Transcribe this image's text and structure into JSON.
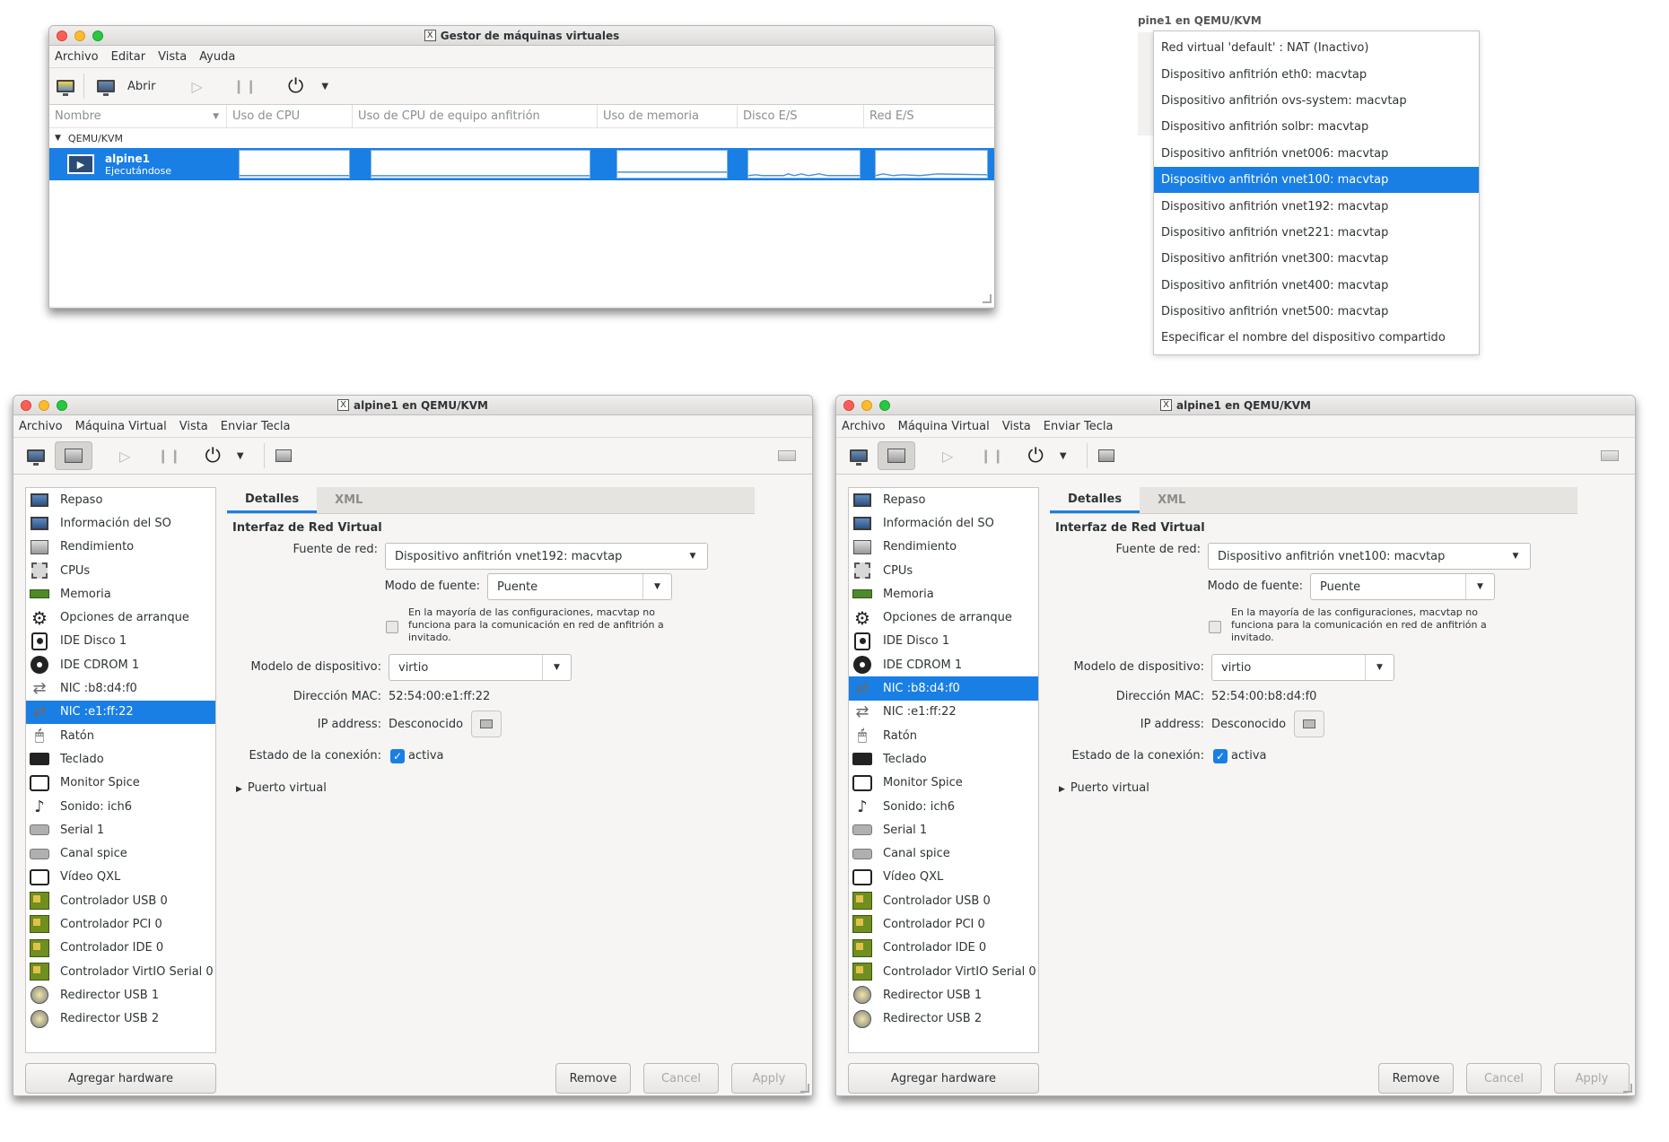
{
  "manager": {
    "title": "Gestor de máquinas virtuales",
    "menu": [
      "Archivo",
      "Editar",
      "Vista",
      "Ayuda"
    ],
    "open_label": "Abrir",
    "columns": [
      "Nombre",
      "Uso de CPU",
      "Uso de CPU de equipo anfitrión",
      "Uso de memoria",
      "Disco E/S",
      "Red E/S"
    ],
    "group": "QEMU/KVM",
    "vm_name": "alpine1",
    "vm_state": "Ejecutándose"
  },
  "popup": {
    "partial_title": "pine1 en QEMU/KVM",
    "items": [
      "Red virtual 'default' : NAT (Inactivo)",
      "Dispositivo anfitrión eth0: macvtap",
      "Dispositivo anfitrión ovs-system: macvtap",
      "Dispositivo anfitrión solbr: macvtap",
      "Dispositivo anfitrión vnet006: macvtap",
      "Dispositivo anfitrión vnet100: macvtap",
      "Dispositivo anfitrión vnet192: macvtap",
      "Dispositivo anfitrión vnet221: macvtap",
      "Dispositivo anfitrión vnet300: macvtap",
      "Dispositivo anfitrión vnet400: macvtap",
      "Dispositivo anfitrión vnet500: macvtap",
      "Especificar el nombre del dispositivo compartido"
    ],
    "selected": "Dispositivo anfitrión vnet100: macvtap"
  },
  "details": {
    "title": "alpine1 en QEMU/KVM",
    "menu": [
      "Archivo",
      "Máquina Virtual",
      "Vista",
      "Enviar Tecla"
    ],
    "tab_details": "Detalles",
    "tab_xml": "XML",
    "section_title": "Interfaz de Red Virtual",
    "label_source": "Fuente de red:",
    "label_mode": "Modo de fuente:",
    "mode_value": "Puente",
    "note": "En la mayoría de las configuraciones, macvtap no funciona para la comunicación en red de anfitrión a invitado.",
    "label_model": "Modelo de dispositivo:",
    "model_value": "virtio",
    "label_mac": "Dirección MAC:",
    "label_ip": "IP address:",
    "ip_value": "Desconocido",
    "label_state": "Estado de la conexión:",
    "state_value": "activa",
    "virtual_port": "Puerto virtual",
    "add_hw": "Agregar hardware",
    "remove": "Remove",
    "cancel": "Cancel",
    "apply": "Apply",
    "sidebar": [
      {
        "label": "Repaso",
        "icon": "monitor-icon"
      },
      {
        "label": "Información del SO",
        "icon": "monitor-info-icon"
      },
      {
        "label": "Rendimiento",
        "icon": "performance-icon"
      },
      {
        "label": "CPUs",
        "icon": "cpu-icon"
      },
      {
        "label": "Memoria",
        "icon": "memory-icon"
      },
      {
        "label": "Opciones de arranque",
        "icon": "gear-icon"
      },
      {
        "label": "IDE Disco 1",
        "icon": "disk-icon"
      },
      {
        "label": "IDE CDROM 1",
        "icon": "cdrom-icon"
      },
      {
        "label": "NIC :b8:d4:f0",
        "icon": "network-icon"
      },
      {
        "label": "NIC :e1:ff:22",
        "icon": "network-icon"
      },
      {
        "label": "Ratón",
        "icon": "mouse-icon"
      },
      {
        "label": "Teclado",
        "icon": "keyboard-icon"
      },
      {
        "label": "Monitor Spice",
        "icon": "display-icon"
      },
      {
        "label": "Sonido: ich6",
        "icon": "sound-icon"
      },
      {
        "label": "Serial 1",
        "icon": "serial-icon"
      },
      {
        "label": "Canal spice",
        "icon": "channel-icon"
      },
      {
        "label": "Vídeo QXL",
        "icon": "video-icon"
      },
      {
        "label": "Controlador USB 0",
        "icon": "controller-icon"
      },
      {
        "label": "Controlador PCI 0",
        "icon": "controller-icon"
      },
      {
        "label": "Controlador IDE 0",
        "icon": "controller-icon"
      },
      {
        "label": "Controlador VirtIO Serial 0",
        "icon": "controller-icon"
      },
      {
        "label": "Redirector USB 1",
        "icon": "usb-redirector-icon"
      },
      {
        "label": "Redirector USB 2",
        "icon": "usb-redirector-icon"
      }
    ]
  },
  "left": {
    "source_value": "Dispositivo anfitrión vnet192: macvtap",
    "mac_value": "52:54:00:e1:ff:22",
    "selected_index": 9
  },
  "right": {
    "source_value": "Dispositivo anfitrión vnet100: macvtap",
    "mac_value": "52:54:00:b8:d4:f0",
    "selected_index": 8
  },
  "colors": {
    "accent": "#1a7fe4"
  }
}
